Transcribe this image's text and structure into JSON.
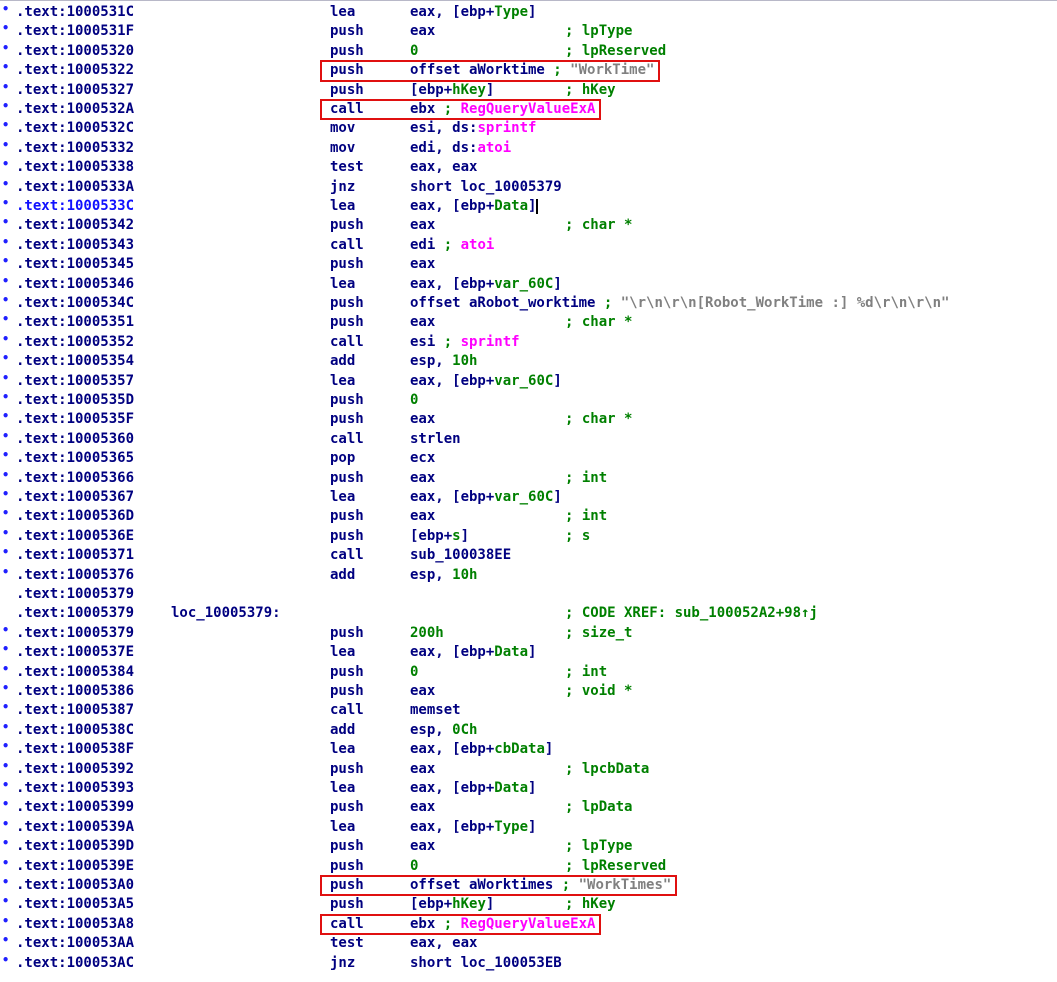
{
  "lines": [
    {
      "mk": "•",
      "addr": ".text:1000531C",
      "label": "",
      "mnem": "lea",
      "ops": [
        [
          "eax, [ebp+",
          "n"
        ],
        [
          "Type",
          "f"
        ],
        [
          "]",
          "n"
        ]
      ],
      "comment": []
    },
    {
      "mk": "•",
      "addr": ".text:1000531F",
      "label": "",
      "mnem": "push",
      "ops": [
        [
          "eax",
          "n"
        ]
      ],
      "comment": [
        [
          "; lpType",
          "c"
        ]
      ]
    },
    {
      "mk": "•",
      "addr": ".text:10005320",
      "label": "",
      "mnem": "push",
      "ops": [
        [
          "0",
          "f"
        ]
      ],
      "comment": [
        [
          "; lpReserved",
          "c"
        ]
      ]
    },
    {
      "mk": "•",
      "addr": ".text:10005322",
      "label": "",
      "mnem": "push",
      "ops": [
        [
          "offset aWorktime",
          "n"
        ],
        [
          " ; ",
          "c"
        ],
        [
          "\"WorkTime\"",
          "s"
        ]
      ],
      "comment": []
    },
    {
      "mk": "•",
      "addr": ".text:10005327",
      "label": "",
      "mnem": "push",
      "ops": [
        [
          "[ebp+",
          "n"
        ],
        [
          "hKey",
          "f"
        ],
        [
          "]",
          "n"
        ]
      ],
      "comment": [
        [
          "; hKey",
          "c"
        ]
      ]
    },
    {
      "mk": "•",
      "addr": ".text:1000532A",
      "label": "",
      "mnem": "call",
      "ops": [
        [
          "ebx",
          "n"
        ],
        [
          " ; ",
          "c"
        ],
        [
          "RegQueryValueExA",
          "a"
        ]
      ],
      "comment": []
    },
    {
      "mk": "•",
      "addr": ".text:1000532C",
      "label": "",
      "mnem": "mov",
      "ops": [
        [
          "esi, ds:",
          "n"
        ],
        [
          "sprintf",
          "a"
        ]
      ],
      "comment": []
    },
    {
      "mk": "•",
      "addr": ".text:10005332",
      "label": "",
      "mnem": "mov",
      "ops": [
        [
          "edi, ds:",
          "n"
        ],
        [
          "atoi",
          "a"
        ]
      ],
      "comment": []
    },
    {
      "mk": "•",
      "addr": ".text:10005338",
      "label": "",
      "mnem": "test",
      "ops": [
        [
          "eax, eax",
          "n"
        ]
      ],
      "comment": []
    },
    {
      "mk": "•",
      "addr": ".text:1000533A",
      "label": "",
      "mnem": "jnz",
      "ops": [
        [
          "short loc_10005379",
          "n"
        ]
      ],
      "comment": []
    },
    {
      "mk": "•",
      "addr": ".text:1000533C",
      "label": "",
      "mnem": "lea",
      "ops": [
        [
          "eax, [ebp+",
          "n"
        ],
        [
          "Data",
          "f"
        ],
        [
          "]",
          "n"
        ]
      ],
      "comment": [],
      "sel": true
    },
    {
      "mk": "•",
      "addr": ".text:10005342",
      "label": "",
      "mnem": "push",
      "ops": [
        [
          "eax",
          "n"
        ]
      ],
      "comment": [
        [
          "; char *",
          "c"
        ]
      ]
    },
    {
      "mk": "•",
      "addr": ".text:10005343",
      "label": "",
      "mnem": "call",
      "ops": [
        [
          "edi",
          "n"
        ],
        [
          " ; ",
          "c"
        ],
        [
          "atoi",
          "a"
        ]
      ],
      "comment": []
    },
    {
      "mk": "•",
      "addr": ".text:10005345",
      "label": "",
      "mnem": "push",
      "ops": [
        [
          "eax",
          "n"
        ]
      ],
      "comment": []
    },
    {
      "mk": "•",
      "addr": ".text:10005346",
      "label": "",
      "mnem": "lea",
      "ops": [
        [
          "eax, [ebp+",
          "n"
        ],
        [
          "var_60C",
          "f"
        ],
        [
          "]",
          "n"
        ]
      ],
      "comment": []
    },
    {
      "mk": "•",
      "addr": ".text:1000534C",
      "label": "",
      "mnem": "push",
      "ops": [
        [
          "offset aRobot_worktime",
          "n"
        ],
        [
          " ; ",
          "c"
        ],
        [
          "\"\\r\\n\\r\\n[Robot_WorkTime :] %d\\r\\n\\r\\n\"",
          "s"
        ]
      ],
      "comment": []
    },
    {
      "mk": "•",
      "addr": ".text:10005351",
      "label": "",
      "mnem": "push",
      "ops": [
        [
          "eax",
          "n"
        ]
      ],
      "comment": [
        [
          "; char *",
          "c"
        ]
      ]
    },
    {
      "mk": "•",
      "addr": ".text:10005352",
      "label": "",
      "mnem": "call",
      "ops": [
        [
          "esi",
          "n"
        ],
        [
          " ; ",
          "c"
        ],
        [
          "sprintf",
          "a"
        ]
      ],
      "comment": []
    },
    {
      "mk": "•",
      "addr": ".text:10005354",
      "label": "",
      "mnem": "add",
      "ops": [
        [
          "esp, ",
          "n"
        ],
        [
          "10h",
          "f"
        ]
      ],
      "comment": []
    },
    {
      "mk": "•",
      "addr": ".text:10005357",
      "label": "",
      "mnem": "lea",
      "ops": [
        [
          "eax, [ebp+",
          "n"
        ],
        [
          "var_60C",
          "f"
        ],
        [
          "]",
          "n"
        ]
      ],
      "comment": []
    },
    {
      "mk": "•",
      "addr": ".text:1000535D",
      "label": "",
      "mnem": "push",
      "ops": [
        [
          "0",
          "f"
        ]
      ],
      "comment": []
    },
    {
      "mk": "•",
      "addr": ".text:1000535F",
      "label": "",
      "mnem": "push",
      "ops": [
        [
          "eax",
          "n"
        ]
      ],
      "comment": [
        [
          "; char *",
          "c"
        ]
      ]
    },
    {
      "mk": "•",
      "addr": ".text:10005360",
      "label": "",
      "mnem": "call",
      "ops": [
        [
          "strlen",
          "n"
        ]
      ],
      "comment": []
    },
    {
      "mk": "•",
      "addr": ".text:10005365",
      "label": "",
      "mnem": "pop",
      "ops": [
        [
          "ecx",
          "n"
        ]
      ],
      "comment": []
    },
    {
      "mk": "•",
      "addr": ".text:10005366",
      "label": "",
      "mnem": "push",
      "ops": [
        [
          "eax",
          "n"
        ]
      ],
      "comment": [
        [
          "; int",
          "c"
        ]
      ]
    },
    {
      "mk": "•",
      "addr": ".text:10005367",
      "label": "",
      "mnem": "lea",
      "ops": [
        [
          "eax, [ebp+",
          "n"
        ],
        [
          "var_60C",
          "f"
        ],
        [
          "]",
          "n"
        ]
      ],
      "comment": []
    },
    {
      "mk": "•",
      "addr": ".text:1000536D",
      "label": "",
      "mnem": "push",
      "ops": [
        [
          "eax",
          "n"
        ]
      ],
      "comment": [
        [
          "; int",
          "c"
        ]
      ]
    },
    {
      "mk": "•",
      "addr": ".text:1000536E",
      "label": "",
      "mnem": "push",
      "ops": [
        [
          "[ebp+",
          "n"
        ],
        [
          "s",
          "f"
        ],
        [
          "]",
          "n"
        ]
      ],
      "comment": [
        [
          "; s",
          "c"
        ]
      ]
    },
    {
      "mk": "•",
      "addr": ".text:10005371",
      "label": "",
      "mnem": "call",
      "ops": [
        [
          "sub_100038EE",
          "n"
        ]
      ],
      "comment": []
    },
    {
      "mk": "•",
      "addr": ".text:10005376",
      "label": "",
      "mnem": "add",
      "ops": [
        [
          "esp, ",
          "n"
        ],
        [
          "10h",
          "f"
        ]
      ],
      "comment": []
    },
    {
      "mk": "",
      "addr": ".text:10005379",
      "label": "",
      "mnem": "",
      "ops": [],
      "comment": []
    },
    {
      "mk": "",
      "addr": ".text:10005379",
      "label": "loc_10005379:",
      "mnem": "",
      "ops": [],
      "comment": [
        [
          "; CODE XREF: sub_100052A2+98↑j",
          "c"
        ]
      ]
    },
    {
      "mk": "•",
      "addr": ".text:10005379",
      "label": "",
      "mnem": "push",
      "ops": [
        [
          "200h",
          "f"
        ]
      ],
      "comment": [
        [
          "; size_t",
          "c"
        ]
      ]
    },
    {
      "mk": "•",
      "addr": ".text:1000537E",
      "label": "",
      "mnem": "lea",
      "ops": [
        [
          "eax, [ebp+",
          "n"
        ],
        [
          "Data",
          "f"
        ],
        [
          "]",
          "n"
        ]
      ],
      "comment": []
    },
    {
      "mk": "•",
      "addr": ".text:10005384",
      "label": "",
      "mnem": "push",
      "ops": [
        [
          "0",
          "f"
        ]
      ],
      "comment": [
        [
          "; int",
          "c"
        ]
      ]
    },
    {
      "mk": "•",
      "addr": ".text:10005386",
      "label": "",
      "mnem": "push",
      "ops": [
        [
          "eax",
          "n"
        ]
      ],
      "comment": [
        [
          "; void *",
          "c"
        ]
      ]
    },
    {
      "mk": "•",
      "addr": ".text:10005387",
      "label": "",
      "mnem": "call",
      "ops": [
        [
          "memset",
          "n"
        ]
      ],
      "comment": []
    },
    {
      "mk": "•",
      "addr": ".text:1000538C",
      "label": "",
      "mnem": "add",
      "ops": [
        [
          "esp, ",
          "n"
        ],
        [
          "0Ch",
          "f"
        ]
      ],
      "comment": []
    },
    {
      "mk": "•",
      "addr": ".text:1000538F",
      "label": "",
      "mnem": "lea",
      "ops": [
        [
          "eax, [ebp+",
          "n"
        ],
        [
          "cbData",
          "f"
        ],
        [
          "]",
          "n"
        ]
      ],
      "comment": []
    },
    {
      "mk": "•",
      "addr": ".text:10005392",
      "label": "",
      "mnem": "push",
      "ops": [
        [
          "eax",
          "n"
        ]
      ],
      "comment": [
        [
          "; lpcbData",
          "c"
        ]
      ]
    },
    {
      "mk": "•",
      "addr": ".text:10005393",
      "label": "",
      "mnem": "lea",
      "ops": [
        [
          "eax, [ebp+",
          "n"
        ],
        [
          "Data",
          "f"
        ],
        [
          "]",
          "n"
        ]
      ],
      "comment": []
    },
    {
      "mk": "•",
      "addr": ".text:10005399",
      "label": "",
      "mnem": "push",
      "ops": [
        [
          "eax",
          "n"
        ]
      ],
      "comment": [
        [
          "; lpData",
          "c"
        ]
      ]
    },
    {
      "mk": "•",
      "addr": ".text:1000539A",
      "label": "",
      "mnem": "lea",
      "ops": [
        [
          "eax, [ebp+",
          "n"
        ],
        [
          "Type",
          "f"
        ],
        [
          "]",
          "n"
        ]
      ],
      "comment": []
    },
    {
      "mk": "•",
      "addr": ".text:1000539D",
      "label": "",
      "mnem": "push",
      "ops": [
        [
          "eax",
          "n"
        ]
      ],
      "comment": [
        [
          "; lpType",
          "c"
        ]
      ]
    },
    {
      "mk": "•",
      "addr": ".text:1000539E",
      "label": "",
      "mnem": "push",
      "ops": [
        [
          "0",
          "f"
        ]
      ],
      "comment": [
        [
          "; lpReserved",
          "c"
        ]
      ]
    },
    {
      "mk": "•",
      "addr": ".text:100053A0",
      "label": "",
      "mnem": "push",
      "ops": [
        [
          "offset aWorktimes",
          "n"
        ],
        [
          " ; ",
          "c"
        ],
        [
          "\"WorkTimes\"",
          "s"
        ]
      ],
      "comment": []
    },
    {
      "mk": "•",
      "addr": ".text:100053A5",
      "label": "",
      "mnem": "push",
      "ops": [
        [
          "[ebp+",
          "n"
        ],
        [
          "hKey",
          "f"
        ],
        [
          "]",
          "n"
        ]
      ],
      "comment": [
        [
          "; hKey",
          "c"
        ]
      ]
    },
    {
      "mk": "•",
      "addr": ".text:100053A8",
      "label": "",
      "mnem": "call",
      "ops": [
        [
          "ebx",
          "n"
        ],
        [
          " ; ",
          "c"
        ],
        [
          "RegQueryValueExA",
          "a"
        ]
      ],
      "comment": []
    },
    {
      "mk": "•",
      "addr": ".text:100053AA",
      "label": "",
      "mnem": "test",
      "ops": [
        [
          "eax, eax",
          "n"
        ]
      ],
      "comment": []
    },
    {
      "mk": "•",
      "addr": ".text:100053AC",
      "label": "",
      "mnem": "jnz",
      "ops": [
        [
          "short loc_100053EB",
          "n"
        ]
      ],
      "comment": []
    }
  ],
  "highlights": [
    3,
    5,
    45,
    47
  ],
  "colors": {
    "address": "#000080",
    "comment": "#008000",
    "string": "#808080",
    "api": "#ff00ff",
    "highlight_box": "#e01010",
    "marker": "#2020ff"
  }
}
